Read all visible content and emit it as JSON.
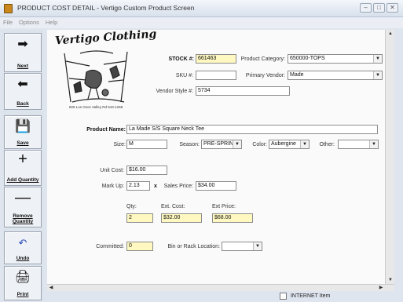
{
  "window": {
    "title": "PRODUCT COST DETAIL - Vertigo Custom Product Screen",
    "controls": [
      "–",
      "□",
      "✕"
    ]
  },
  "menu": {
    "items": [
      "File",
      "Options",
      "Help"
    ]
  },
  "toolbar": {
    "next": "Next",
    "back": "Back",
    "save": "Save",
    "add_quantity": "Add Quantity",
    "remove_quantity": "Remove Quantity",
    "undo": "Undo",
    "print": "Print"
  },
  "logo": {
    "title": "Vertigo Clothing",
    "subtitle": "825 Los Osos Valley Rd 543-1258"
  },
  "form": {
    "stock_label": "STOCK #:",
    "stock_value": "661463",
    "product_category_label": "Product Category:",
    "product_category_value": "650000-TOPS",
    "sku_label": "SKU #:",
    "sku_value": "",
    "primary_vendor_label": "Primary Vendor:",
    "primary_vendor_value": "Made",
    "vendor_style_label": "Vendor Style #:",
    "vendor_style_value": "5734",
    "product_name_label": "Product Name:",
    "product_name_value": "La Made S/S Square Neck Tee",
    "size_label": "Size:",
    "size_value": "M",
    "season_label": "Season:",
    "season_value": "PRE-SPRIN",
    "color_label": "Color:",
    "color_value": "Aubergine",
    "other_label": "Other:",
    "other_value": "",
    "unit_cost_label": "Unit Cost:",
    "unit_cost_value": "$16.00",
    "markup_label": "Mark Up:",
    "markup_value": "2.13",
    "times_symbol": "x",
    "sales_price_label": "Sales Price:",
    "sales_price_value": "$34.00",
    "qty_label": "Qty:",
    "qty_value": "2",
    "ext_cost_label": "Ext. Cost:",
    "ext_cost_value": "$32.00",
    "ext_price_label": "Ext Price:",
    "ext_price_value": "$68.00",
    "committed_label": "Committed:",
    "committed_value": "0",
    "bin_label": "Bin or Rack Location:",
    "bin_value": "",
    "internet_item_label": "INTERNET Item"
  },
  "colors": {
    "highlight_field": "#fff8c0",
    "window_bg": "#dfe5ee"
  }
}
